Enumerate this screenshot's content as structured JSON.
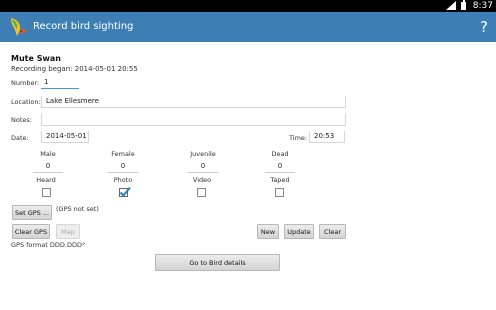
{
  "status_bar": {
    "time": "8:37",
    "signal_icon": "signal-icon",
    "battery_icon": "battery-icon"
  },
  "action_bar": {
    "title": "Record bird sighting",
    "help_label": "?",
    "app_icon": "bird-app-icon",
    "color": "#3d7fb4"
  },
  "sighting": {
    "species": "Mute Swan",
    "recording_began": "Recording began: 2014-05-01 20:55"
  },
  "form": {
    "number_label": "Number:",
    "number_value": "1",
    "location_label": "Location:",
    "location_value": "Lake Ellesmere",
    "notes_label": "Notes:",
    "notes_value": "",
    "date_label": "Date:",
    "date_value": "2014-05-01",
    "time_label": "Time:",
    "time_value": "20:53"
  },
  "counts": {
    "male_label": "Male",
    "male_value": "0",
    "female_label": "Female",
    "female_value": "0",
    "juvenile_label": "Juvenile",
    "juvenile_value": "0",
    "dead_label": "Dead",
    "dead_value": "0"
  },
  "checks": {
    "heard_label": "Heard",
    "heard_checked": false,
    "photo_label": "Photo",
    "photo_checked": true,
    "video_label": "Video",
    "video_checked": false,
    "taped_label": "Taped",
    "taped_checked": false
  },
  "gps": {
    "set_gps_label": "Set GPS ...",
    "gps_status": "(GPS not set)",
    "clear_gps_label": "Clear GPS",
    "map_label": "Map",
    "format_note": "GPS format DDD.DDD°"
  },
  "actions": {
    "new_label": "New",
    "update_label": "Update",
    "clear_label": "Clear",
    "goto_details_label": "Go to Bird details"
  },
  "colors": {
    "accent": "#3d9bd4",
    "check": "#2a7fc4"
  }
}
